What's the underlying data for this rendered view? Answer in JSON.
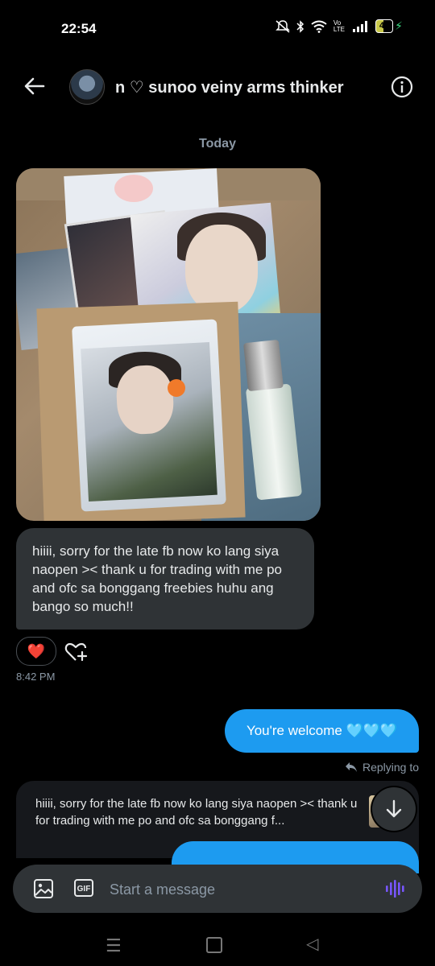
{
  "status_bar": {
    "time": "22:54",
    "network": "Vo LTE",
    "battery": "44"
  },
  "header": {
    "title": "n ♡ sunoo veiny arms thinker"
  },
  "date_separator": "Today",
  "messages": {
    "received_text": "hiiii, sorry for the late fb now ko lang siya naopen >< thank u for trading with me po and ofc sa bonggang freebies huhu ang bango so much!!",
    "received_reaction": "❤️",
    "received_time": "8:42 PM",
    "sent_text": "You're welcome 🩵🩵🩵",
    "replying_label": "Replying to",
    "reply_quote": "hiiii, sorry for the late fb now ko lang siya naopen >< thank u for trading with me po and ofc sa bonggang f..."
  },
  "composer": {
    "placeholder": "Start a message",
    "gif_label": "GIF"
  },
  "nav": {
    "menu": "☰",
    "back": "◁"
  },
  "colors": {
    "accent": "#1d9bf0",
    "received_bubble": "#2f3336",
    "background": "#000000",
    "voice": "#7856ff"
  }
}
